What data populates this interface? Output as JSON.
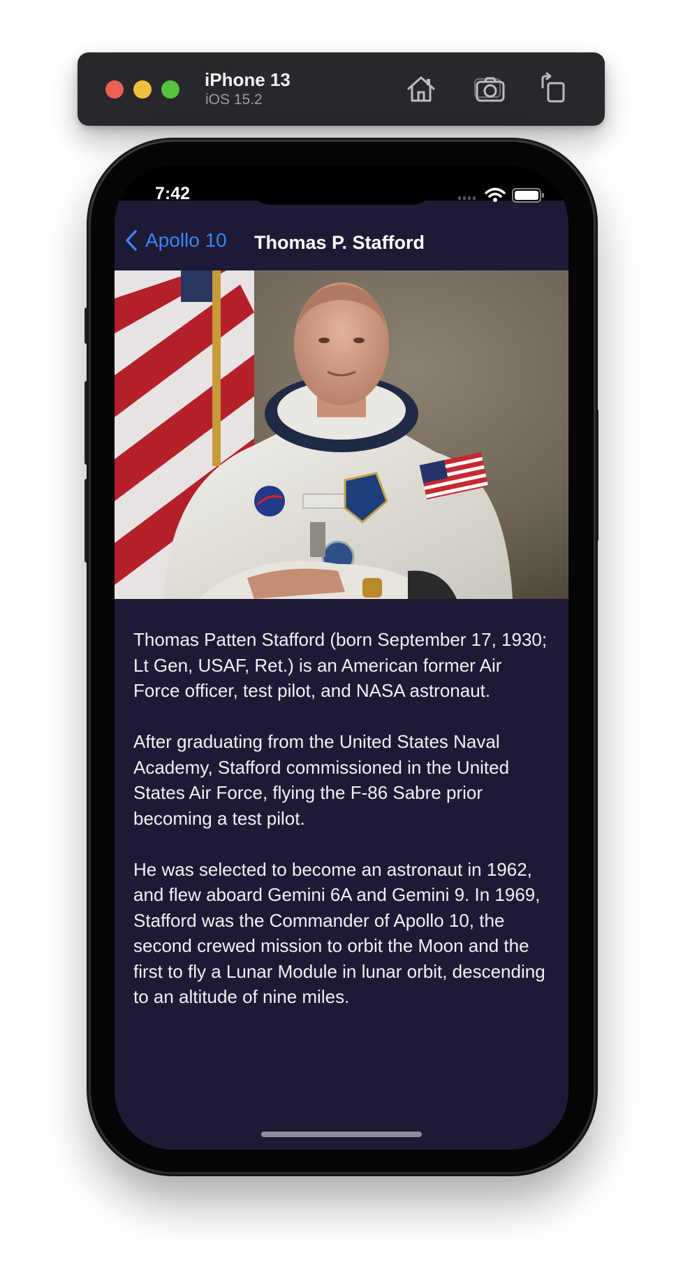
{
  "simulator": {
    "device_name": "iPhone 13",
    "os_version": "iOS 15.2",
    "icons": [
      "home-icon",
      "screenshot-icon",
      "rotate-icon"
    ]
  },
  "status_bar": {
    "time": "7:42",
    "icons": [
      "signal-icon",
      "wifi-icon",
      "battery-icon"
    ]
  },
  "nav": {
    "back_label": "Apollo 10",
    "title": "Thomas P. Stafford"
  },
  "photo": {
    "subject": "astronaut-portrait"
  },
  "bio": {
    "paragraphs": [
      "Thomas Patten Stafford (born September 17, 1930; Lt Gen, USAF, Ret.) is an American former Air Force officer, test pilot, and NASA astronaut.",
      "After graduating from the United States Naval Academy, Stafford commissioned in the United States Air Force, flying the F-86 Sabre prior becoming a test pilot.",
      "He was selected to become an astronaut in 1962, and flew aboard Gemini 6A and Gemini 9. In 1969, Stafford was the Commander of Apollo 10, the second crewed mission to orbit the Moon and the first to fly a Lunar Module in lunar orbit, descending to an altitude of nine miles."
    ]
  },
  "colors": {
    "background": "#1c1a34",
    "accent": "#3d83f5",
    "text": "#f1f1f5"
  }
}
